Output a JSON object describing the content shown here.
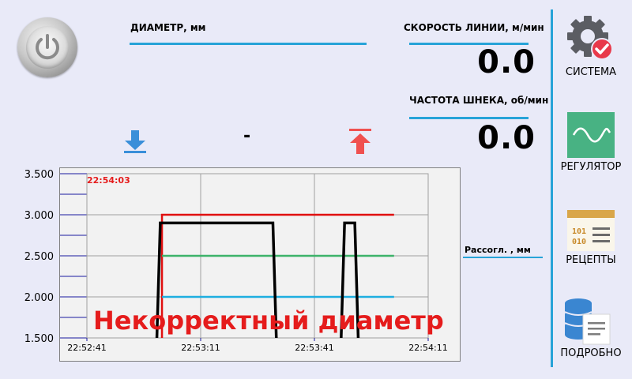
{
  "header": {
    "diameter_label": "ДИАМЕТР, мм",
    "line_speed_label": "СКОРОСТЬ ЛИНИИ, м/мин",
    "line_speed_value": "0.0",
    "screw_freq_label": "ЧАСТОТА ШНЕКА, об/мин",
    "screw_freq_value": "0.0",
    "diameter_value": "-"
  },
  "sidebar": {
    "items": [
      {
        "label": "СИСТЕМА",
        "icon": "gear-icon"
      },
      {
        "label": "РЕГУЛЯТОР",
        "icon": "wave-icon"
      },
      {
        "label": "РЕЦЕПТЫ",
        "icon": "recipe-icon"
      },
      {
        "label": "ПОДРОБНО",
        "icon": "database-icon"
      }
    ]
  },
  "colors": {
    "accent": "#27a3d8",
    "down_arrow": "#3a8fd9",
    "up_arrow": "#f0504f",
    "error": "#e51c1c"
  },
  "chart_data": {
    "type": "line",
    "timestamp": "22:54:03",
    "right_label": "Рассогл. , мм",
    "error_message": "Некорректный диаметр",
    "y_ticks": [
      "3.500",
      "3.000",
      "2.500",
      "2.000",
      "1.500"
    ],
    "x_ticks": [
      "22:52:41",
      "22:53:11",
      "22:53:41",
      "22:54:11"
    ],
    "ylim": [
      1.5,
      3.5
    ],
    "series": [
      {
        "color": "#e01010",
        "points": [
          [
            0.22,
            1.5
          ],
          [
            0.22,
            3.0
          ],
          [
            0.9,
            3.0
          ]
        ]
      },
      {
        "color": "#3db36a",
        "points": [
          [
            0.22,
            2.5
          ],
          [
            0.9,
            2.5
          ]
        ]
      },
      {
        "color": "#1eaee0",
        "points": [
          [
            0.22,
            2.0
          ],
          [
            0.9,
            2.0
          ]
        ]
      },
      {
        "color": "#000000",
        "points": [
          [
            0.205,
            1.5
          ],
          [
            0.215,
            2.9
          ],
          [
            0.545,
            2.9
          ],
          [
            0.555,
            1.5
          ]
        ]
      },
      {
        "color": "#000000",
        "points": [
          [
            0.745,
            1.5
          ],
          [
            0.755,
            2.9
          ],
          [
            0.785,
            2.9
          ],
          [
            0.795,
            1.5
          ]
        ]
      }
    ]
  }
}
